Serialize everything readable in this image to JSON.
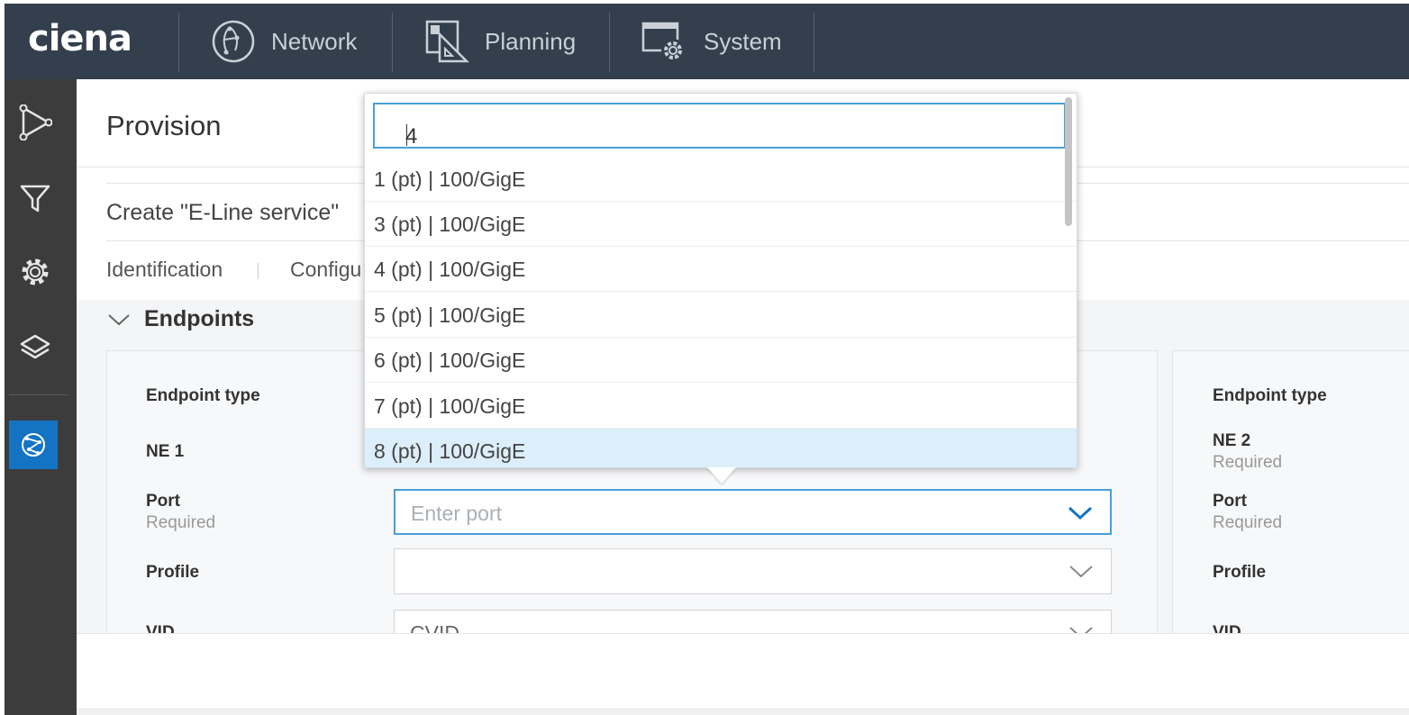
{
  "brand": {
    "logo_text": "ciena"
  },
  "topnav": {
    "items": [
      {
        "label": "Network",
        "icon": "globe-icon"
      },
      {
        "label": "Planning",
        "icon": "planning-icon"
      },
      {
        "label": "System",
        "icon": "system-gear-icon"
      }
    ]
  },
  "rail": {
    "icons": [
      "topology-icon",
      "filter-icon",
      "settings-gear-icon",
      "layers-icon",
      "service-globe-icon"
    ],
    "active_color": "#1474c3"
  },
  "page": {
    "title": "Provision",
    "subtitle": "Create \"E-Line service\"",
    "tabs": [
      "Identification",
      "Configu"
    ]
  },
  "endpoints": {
    "section_label": "Endpoints",
    "left": {
      "endpoint_type_label": "Endpoint type",
      "ne_label": "NE 1",
      "port_label": "Port",
      "port_required": "Required",
      "port_placeholder": "Enter port",
      "profile_label": "Profile",
      "vid_label": "VID",
      "vid_value": "CVID"
    },
    "right": {
      "endpoint_type_label": "Endpoint type",
      "ne_label": "NE 2",
      "ne_required": "Required",
      "port_label": "Port",
      "port_required": "Required",
      "profile_label": "Profile",
      "vid_label": "VID"
    }
  },
  "port_dropdown": {
    "search_value": "4",
    "options": [
      "1 (pt) | 100/GigE",
      "3 (pt) | 100/GigE",
      "4 (pt) | 100/GigE",
      "5 (pt) | 100/GigE",
      "6 (pt) | 100/GigE",
      "7 (pt) | 100/GigE",
      "8 (pt) | 100/GigE"
    ],
    "highlighted_option": "8 (pt) | 100/GigE",
    "accent_color": "#48a0d8"
  },
  "colors": {
    "topbar_bg": "#333f4c",
    "rail_bg": "#3c3c3c",
    "highlight_bg": "#dceefa"
  }
}
